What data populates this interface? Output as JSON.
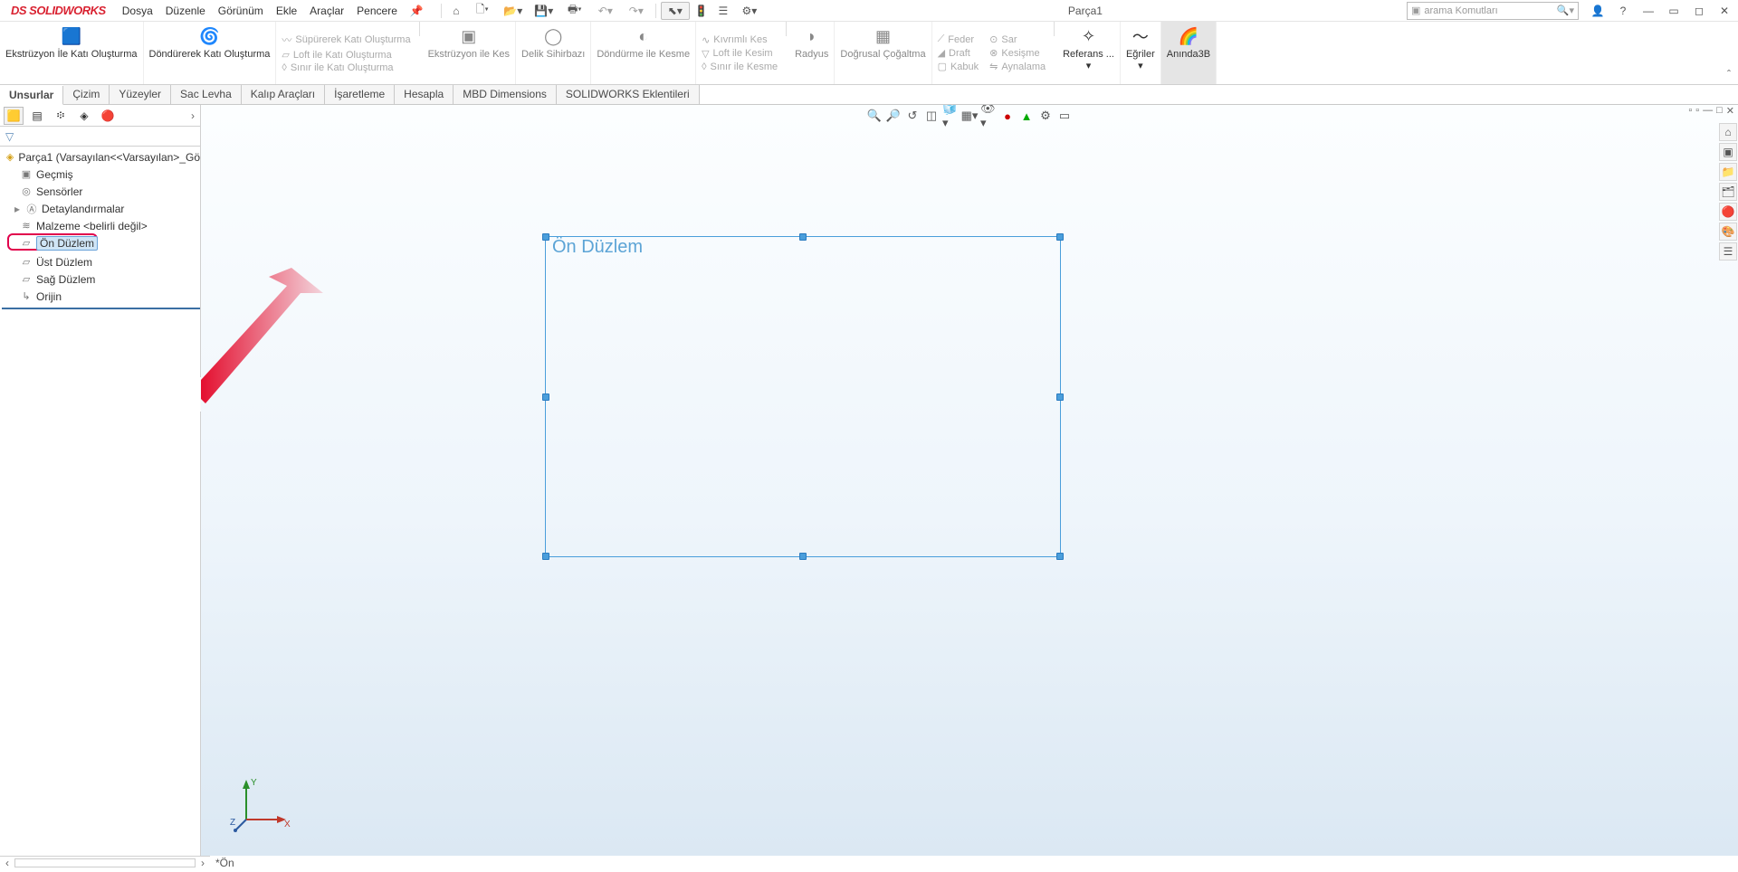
{
  "app": {
    "name": "SOLIDWORKS",
    "doc_title": "Parça1"
  },
  "menu": [
    "Dosya",
    "Düzenle",
    "Görünüm",
    "Ekle",
    "Araçlar",
    "Pencere"
  ],
  "search": {
    "placeholder": "arama Komutları"
  },
  "ribbon_big": [
    {
      "label": "Ekstrüzyon İle Katı Oluşturma",
      "enabled": true
    },
    {
      "label": "Döndürerek Katı Oluşturma",
      "enabled": true
    }
  ],
  "ribbon_col1": [
    "Süpürerek Katı Oluşturma",
    "Loft ile Katı Oluşturma",
    "Sınır ile Katı Oluşturma"
  ],
  "ribbon_mid": [
    "Ekstrüzyon ile Kes",
    "Delik Sihirbazı",
    "Döndürme ile Kesme"
  ],
  "ribbon_col2": [
    "Kıvrımlı Kes",
    "Loft ile Kesim",
    "Sınır ile Kesme"
  ],
  "ribbon_mid2": [
    "Radyus",
    "Doğrusal Çoğaltma"
  ],
  "ribbon_col3": [
    "Feder",
    "Draft",
    "Kabuk"
  ],
  "ribbon_col4": [
    "Sar",
    "Kesişme",
    "Aynalama"
  ],
  "ribbon_right": [
    "Referans ...",
    "Eğriler",
    "Anında3B"
  ],
  "tabs": [
    "Unsurlar",
    "Çizim",
    "Yüzeyler",
    "Sac Levha",
    "Kalıp Araçları",
    "İşaretleme",
    "Hesapla",
    "MBD Dimensions",
    "SOLIDWORKS Eklentileri"
  ],
  "tree": {
    "root": "Parça1  (Varsayılan<<Varsayılan>_Gö",
    "items": [
      "Geçmiş",
      "Sensörler",
      "Detaylandırmalar",
      "Malzeme <belirli değil>",
      "Ön Düzlem",
      "Üst Düzlem",
      "Sağ Düzlem",
      "Orijin"
    ]
  },
  "canvas": {
    "plane_label": "Ön Düzlem"
  },
  "status": {
    "text": "*Ön"
  },
  "triad": {
    "x": "X",
    "y": "Y",
    "z": "Z"
  }
}
